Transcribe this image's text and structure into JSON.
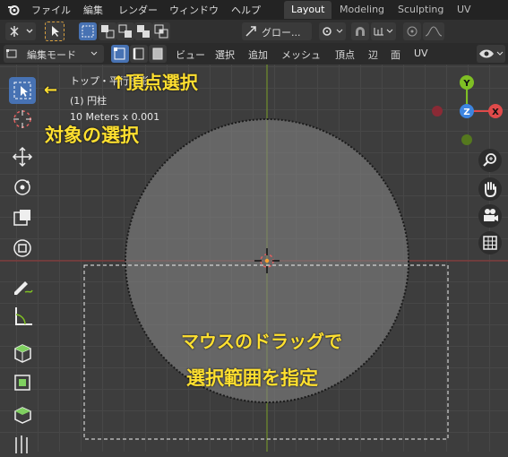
{
  "menubar": {
    "items": [
      "ファイル",
      "編集",
      "レンダー",
      "ウィンドウ",
      "ヘルプ"
    ],
    "workspaces": [
      "Layout",
      "Modeling",
      "Sculpting",
      "UV Editin"
    ]
  },
  "toolbar": {
    "transform_orientation": "グロー...",
    "mode": "編集モード",
    "menus": [
      "ビュー",
      "選択",
      "追加",
      "メッシュ",
      "頂点",
      "辺",
      "面",
      "UV"
    ]
  },
  "viewport": {
    "view_name": "トップ・平行投影",
    "object_name": "(1) 円柱",
    "scale_text": "10 Meters x 0.001"
  },
  "gizmo": {
    "y": "Y",
    "z": "Z",
    "x": "X"
  },
  "annotations": {
    "vertex_select": "↑頂点選択",
    "arrow_left": "←",
    "object_select": "対象の選択",
    "drag_line1": "マウスのドラッグで",
    "drag_line2": "選択範囲を指定"
  },
  "colors": {
    "accent": "#4772b3",
    "annotation": "#ffe030",
    "x_axis": "#e04a4a",
    "y_axis": "#7fbf24",
    "z_axis": "#3d85e0"
  }
}
